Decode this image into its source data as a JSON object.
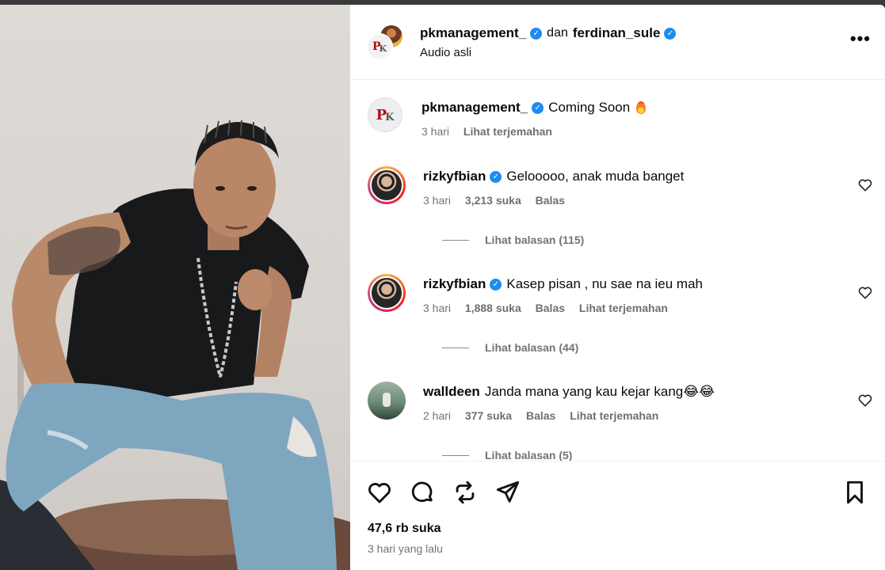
{
  "header": {
    "user1": "pkmanagement_",
    "connector": "dan",
    "user2": "ferdinan_sule",
    "subtitle": "Audio asli",
    "more_icon": "more-horizontal-icon"
  },
  "caption": {
    "username": "pkmanagement_",
    "text": "Coming Soon",
    "emoji_icon": "fire-emoji",
    "time": "3 hari",
    "translate": "Lihat terjemahan"
  },
  "comments": [
    {
      "username": "rizkyfbian",
      "verified": true,
      "text": "Gelooooo, anak muda banget",
      "time": "3 hari",
      "likes": "3,213 suka",
      "reply": "Balas",
      "translate": "",
      "view_replies": "Lihat balasan (115)"
    },
    {
      "username": "rizkyfbian",
      "verified": true,
      "text": "Kasep pisan , nu sae na ieu mah",
      "time": "3 hari",
      "likes": "1,888 suka",
      "reply": "Balas",
      "translate": "Lihat terjemahan",
      "view_replies": "Lihat balasan (44)"
    },
    {
      "username": "walldeen",
      "verified": false,
      "text": "Janda mana yang kau kejar kang😂😂",
      "time": "2 hari",
      "likes": "377 suka",
      "reply": "Balas",
      "translate": "Lihat terjemahan",
      "view_replies": "Lihat balasan (5)"
    }
  ],
  "footer": {
    "likes": "47,6 rb suka",
    "date": "3 hari yang lalu"
  },
  "colors": {
    "verified": "#1d8cf0",
    "muted": "#737373"
  }
}
